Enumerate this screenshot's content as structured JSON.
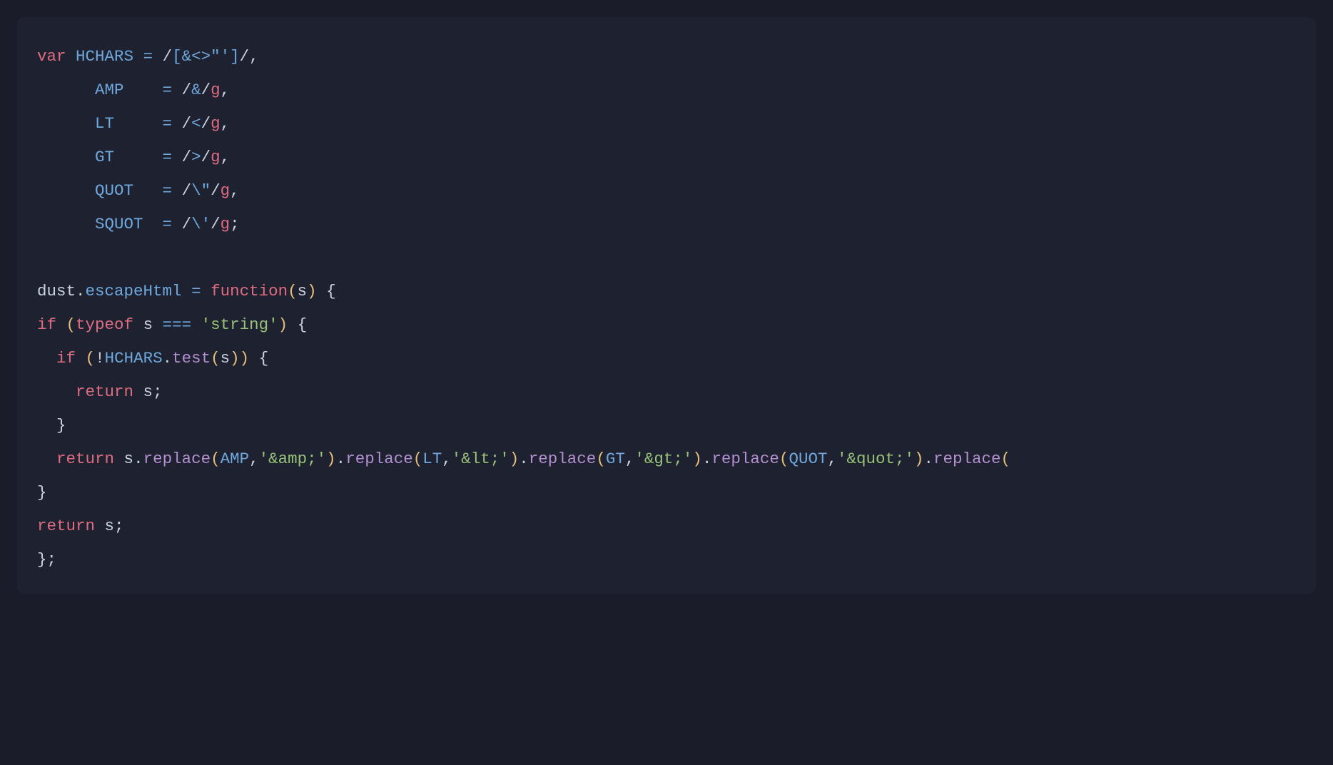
{
  "code": {
    "line1": {
      "kw_var": "var",
      "name": "HCHARS",
      "eq": "=",
      "slash1": "/",
      "body": "[&<>\"']",
      "slash2": "/",
      "comma": ","
    },
    "line2": {
      "name": "AMP",
      "eq": "=",
      "slash1": "/",
      "body": "&",
      "slash2": "/",
      "flag": "g",
      "comma": ","
    },
    "line3": {
      "name": "LT",
      "eq": "=",
      "slash1": "/",
      "body": "<",
      "slash2": "/",
      "flag": "g",
      "comma": ","
    },
    "line4": {
      "name": "GT",
      "eq": "=",
      "slash1": "/",
      "body": ">",
      "slash2": "/",
      "flag": "g",
      "comma": ","
    },
    "line5": {
      "name": "QUOT",
      "eq": "=",
      "slash1": "/",
      "body": "\\\"",
      "slash2": "/",
      "flag": "g",
      "comma": ","
    },
    "line6": {
      "name": "SQUOT",
      "eq": "=",
      "slash1": "/",
      "body": "\\'",
      "slash2": "/",
      "flag": "g",
      "semi": ";"
    },
    "line8": {
      "obj": "dust",
      "dot": ".",
      "prop": "escapeHtml",
      "eq": "=",
      "kw_function": "function",
      "lp": "(",
      "param": "s",
      "rp": ")",
      "brace": "{"
    },
    "line9": {
      "kw_if": "if",
      "lp": "(",
      "kw_typeof": "typeof",
      "var": "s",
      "eqeqeq": "===",
      "str": "'string'",
      "rp": ")",
      "brace": "{"
    },
    "line10": {
      "kw_if": "if",
      "lp": "(",
      "bang": "!",
      "name": "HCHARS",
      "dot": ".",
      "method": "test",
      "lp2": "(",
      "arg": "s",
      "rp2": ")",
      "rp": ")",
      "brace": "{"
    },
    "line11": {
      "kw_return": "return",
      "var": "s",
      "semi": ";"
    },
    "line12": {
      "brace": "}"
    },
    "line13": {
      "kw_return": "return",
      "var": "s",
      "dot1": ".",
      "m1": "replace",
      "lp1": "(",
      "a1a": "AMP",
      "c1": ",",
      "a1b": "'&amp;'",
      "rp1": ")",
      "dot2": ".",
      "m2": "replace",
      "lp2": "(",
      "a2a": "LT",
      "c2": ",",
      "a2b": "'&lt;'",
      "rp2": ")",
      "dot3": ".",
      "m3": "replace",
      "lp3": "(",
      "a3a": "GT",
      "c3": ",",
      "a3b": "'&gt;'",
      "rp3": ")",
      "dot4": ".",
      "m4": "replace",
      "lp4": "(",
      "a4a": "QUOT",
      "c4": ",",
      "a4b": "'&quot;'",
      "rp4": ")",
      "dot5": ".",
      "m5": "replace",
      "lp5": "("
    },
    "line14": {
      "brace": "}"
    },
    "line15": {
      "kw_return": "return",
      "var": "s",
      "semi": ";"
    },
    "line16": {
      "brace": "}",
      "semi": ";"
    }
  }
}
